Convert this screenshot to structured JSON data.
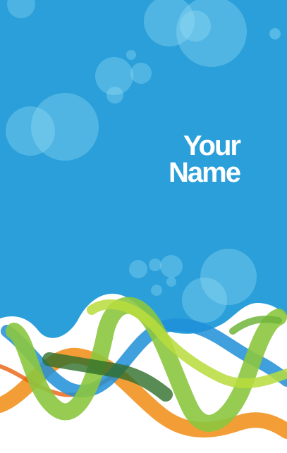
{
  "card": {
    "name_line_1": "Your",
    "name_line_2": "Name"
  },
  "colors": {
    "background_blue": "#2a9fd9",
    "bubble": "#7fd3f3",
    "ribbon_green": "#8cc63f",
    "ribbon_orange": "#f29221",
    "ribbon_blue": "#1f8fd8",
    "ribbon_dark_green": "#2f6e2a",
    "base_white": "#ffffff",
    "text": "#ffffff"
  },
  "decorations": [
    "bokeh-bubbles",
    "wave-ribbons"
  ]
}
